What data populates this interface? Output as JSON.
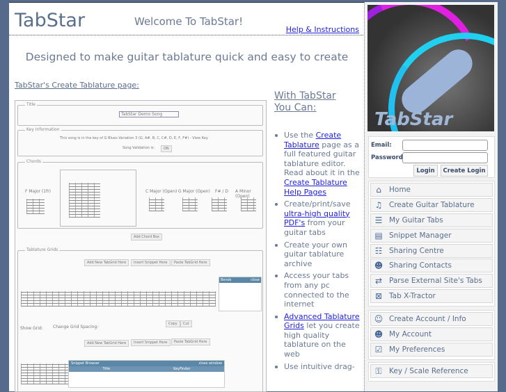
{
  "header": {
    "brand": "TabStar",
    "welcome": "Welcome To TabStar!",
    "help_link": "Help & Instructions"
  },
  "tagline": "Designed to make guitar tablature quick and easy to create",
  "screenshot": {
    "link": "TabStar's Create Tablature page:",
    "title_legend": "Title",
    "song_title": "TabStar Demo Song",
    "key_legend": "Key Information",
    "key_text": "This song is in the key of G Blues Variation 3 (G, A#, B, C, C#, D, E, F, F#) - View Key",
    "validation": "Song Validation is:",
    "validation_value": "ON",
    "chords_legend": "Chords",
    "chords": [
      "F Major (1fr)",
      "C Major (Open)",
      "G Major (Open)",
      "F# / D",
      "A Minor (Open)"
    ],
    "add_chord": "Add Chord Box",
    "grids_legend": "Tablature Grids",
    "grid_buttons": [
      "Add New TabGrid Here",
      "Insert Snippet Here",
      "Paste TabGrid Here"
    ],
    "bends": "Bends",
    "close": "close",
    "show_grid": "Show Grid:",
    "spacing": "Change Grid Spacing:",
    "copy": "Copy",
    "cut": "Cut",
    "snippet_browser": "Snippet Browser",
    "close_window": "close window",
    "col_title": "Title",
    "col_key": "KeyFinder"
  },
  "features": {
    "heading_1": "With TabStar",
    "heading_2": "You Can:",
    "items": [
      {
        "pre": "Use the ",
        "link": "Create Tablature",
        "mid": " page as a full featured guitar tablature editor. Read about it in the ",
        "link2": "Create Tablature Help Pages",
        "post": ""
      },
      {
        "pre": "Create/print/save ",
        "link": "ultra-high quality PDF's",
        "post": " from your guitar tabs"
      },
      {
        "text": "Create your own guitar tablature archive"
      },
      {
        "text": "Access your tabs from any pc connected to the internet"
      },
      {
        "link": "Advanced Tablature Grids",
        "post": " let you create high quality tablature on the web"
      },
      {
        "text": "Use intuitive drag-"
      }
    ]
  },
  "login": {
    "email_label": "Email:",
    "password_label": "Password:",
    "email_value": "",
    "password_value": "",
    "login_button": "Login",
    "create_button": "Create Login"
  },
  "nav": {
    "group1": [
      {
        "label": "Home",
        "icon": "home-icon"
      },
      {
        "label": "Create Guitar Tablature",
        "icon": "tablature-icon"
      },
      {
        "label": "My Guitar Tabs",
        "icon": "list-icon"
      },
      {
        "label": "Snippet Manager",
        "icon": "snippet-icon"
      },
      {
        "label": "Sharing Centre",
        "icon": "share-icon"
      },
      {
        "label": "Sharing Contacts",
        "icon": "contacts-icon"
      },
      {
        "label": "Parse External Site's Tabs",
        "icon": "parse-icon"
      },
      {
        "label": "Tab X-Tractor",
        "icon": "xtractor-icon"
      }
    ],
    "group2": [
      {
        "label": "Create Account / Info",
        "icon": "create-account-icon"
      },
      {
        "label": "My Account",
        "icon": "account-icon"
      },
      {
        "label": "My Preferences",
        "icon": "check-icon"
      }
    ],
    "group3": [
      {
        "label": "Key / Scale Reference",
        "icon": "key-icon"
      }
    ]
  },
  "logo_text": "TabStar"
}
